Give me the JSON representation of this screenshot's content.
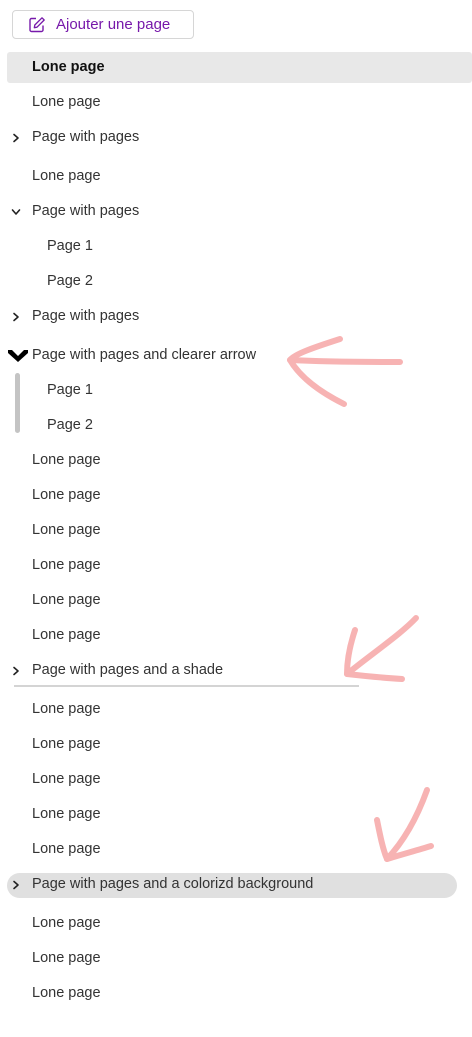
{
  "toolbar": {
    "add_page_label": "Ajouter une page"
  },
  "pages": [
    {
      "label": "Lone page",
      "level": 1,
      "state": "selected"
    },
    {
      "label": "Lone page",
      "level": 1
    },
    {
      "label": "Page with pages",
      "level": 1,
      "state": "collapsed"
    },
    {
      "label": "Lone page",
      "level": 1
    },
    {
      "label": "Page with pages",
      "level": 1,
      "state": "expanded"
    },
    {
      "label": "Page 1",
      "level": 2
    },
    {
      "label": "Page 2",
      "level": 2
    },
    {
      "label": "Page with pages",
      "level": 1,
      "state": "collapsed"
    },
    {
      "label": "Page with pages and clearer arrow",
      "level": 1,
      "state": "expanded-bold-arrow"
    },
    {
      "label": "Page 1",
      "level": 2
    },
    {
      "label": "Page 2",
      "level": 2
    },
    {
      "label": "Lone page",
      "level": 1
    },
    {
      "label": "Lone page",
      "level": 1
    },
    {
      "label": "Lone page",
      "level": 1
    },
    {
      "label": "Lone page",
      "level": 1
    },
    {
      "label": "Lone page",
      "level": 1
    },
    {
      "label": "Lone page",
      "level": 1
    },
    {
      "label": "Page with pages and a shade",
      "level": 1,
      "state": "collapsed-shade"
    },
    {
      "label": "Lone page",
      "level": 1
    },
    {
      "label": "Lone page",
      "level": 1
    },
    {
      "label": "Lone page",
      "level": 1
    },
    {
      "label": "Lone page",
      "level": 1
    },
    {
      "label": "Lone page",
      "level": 1
    },
    {
      "label": "Page with pages and a colorizd background",
      "level": 1,
      "state": "collapsed-colored"
    },
    {
      "label": "Lone page",
      "level": 1
    },
    {
      "label": "Lone page",
      "level": 1
    },
    {
      "label": "Lone page",
      "level": 1
    }
  ],
  "icons": {
    "add_page": "edit-note-icon",
    "collapsed": "chevron-right-icon",
    "expanded": "chevron-down-icon",
    "clear_arrow": "bold-chevron-down-icon",
    "annotation": "pink-arrow-annotation"
  },
  "colors": {
    "accent": "#7719aa",
    "selected_bg": "#e8e8e8",
    "colored_bg": "#e0e0e0",
    "annotation": "#f7b3b3",
    "group_bar": "#c4c4c4"
  }
}
